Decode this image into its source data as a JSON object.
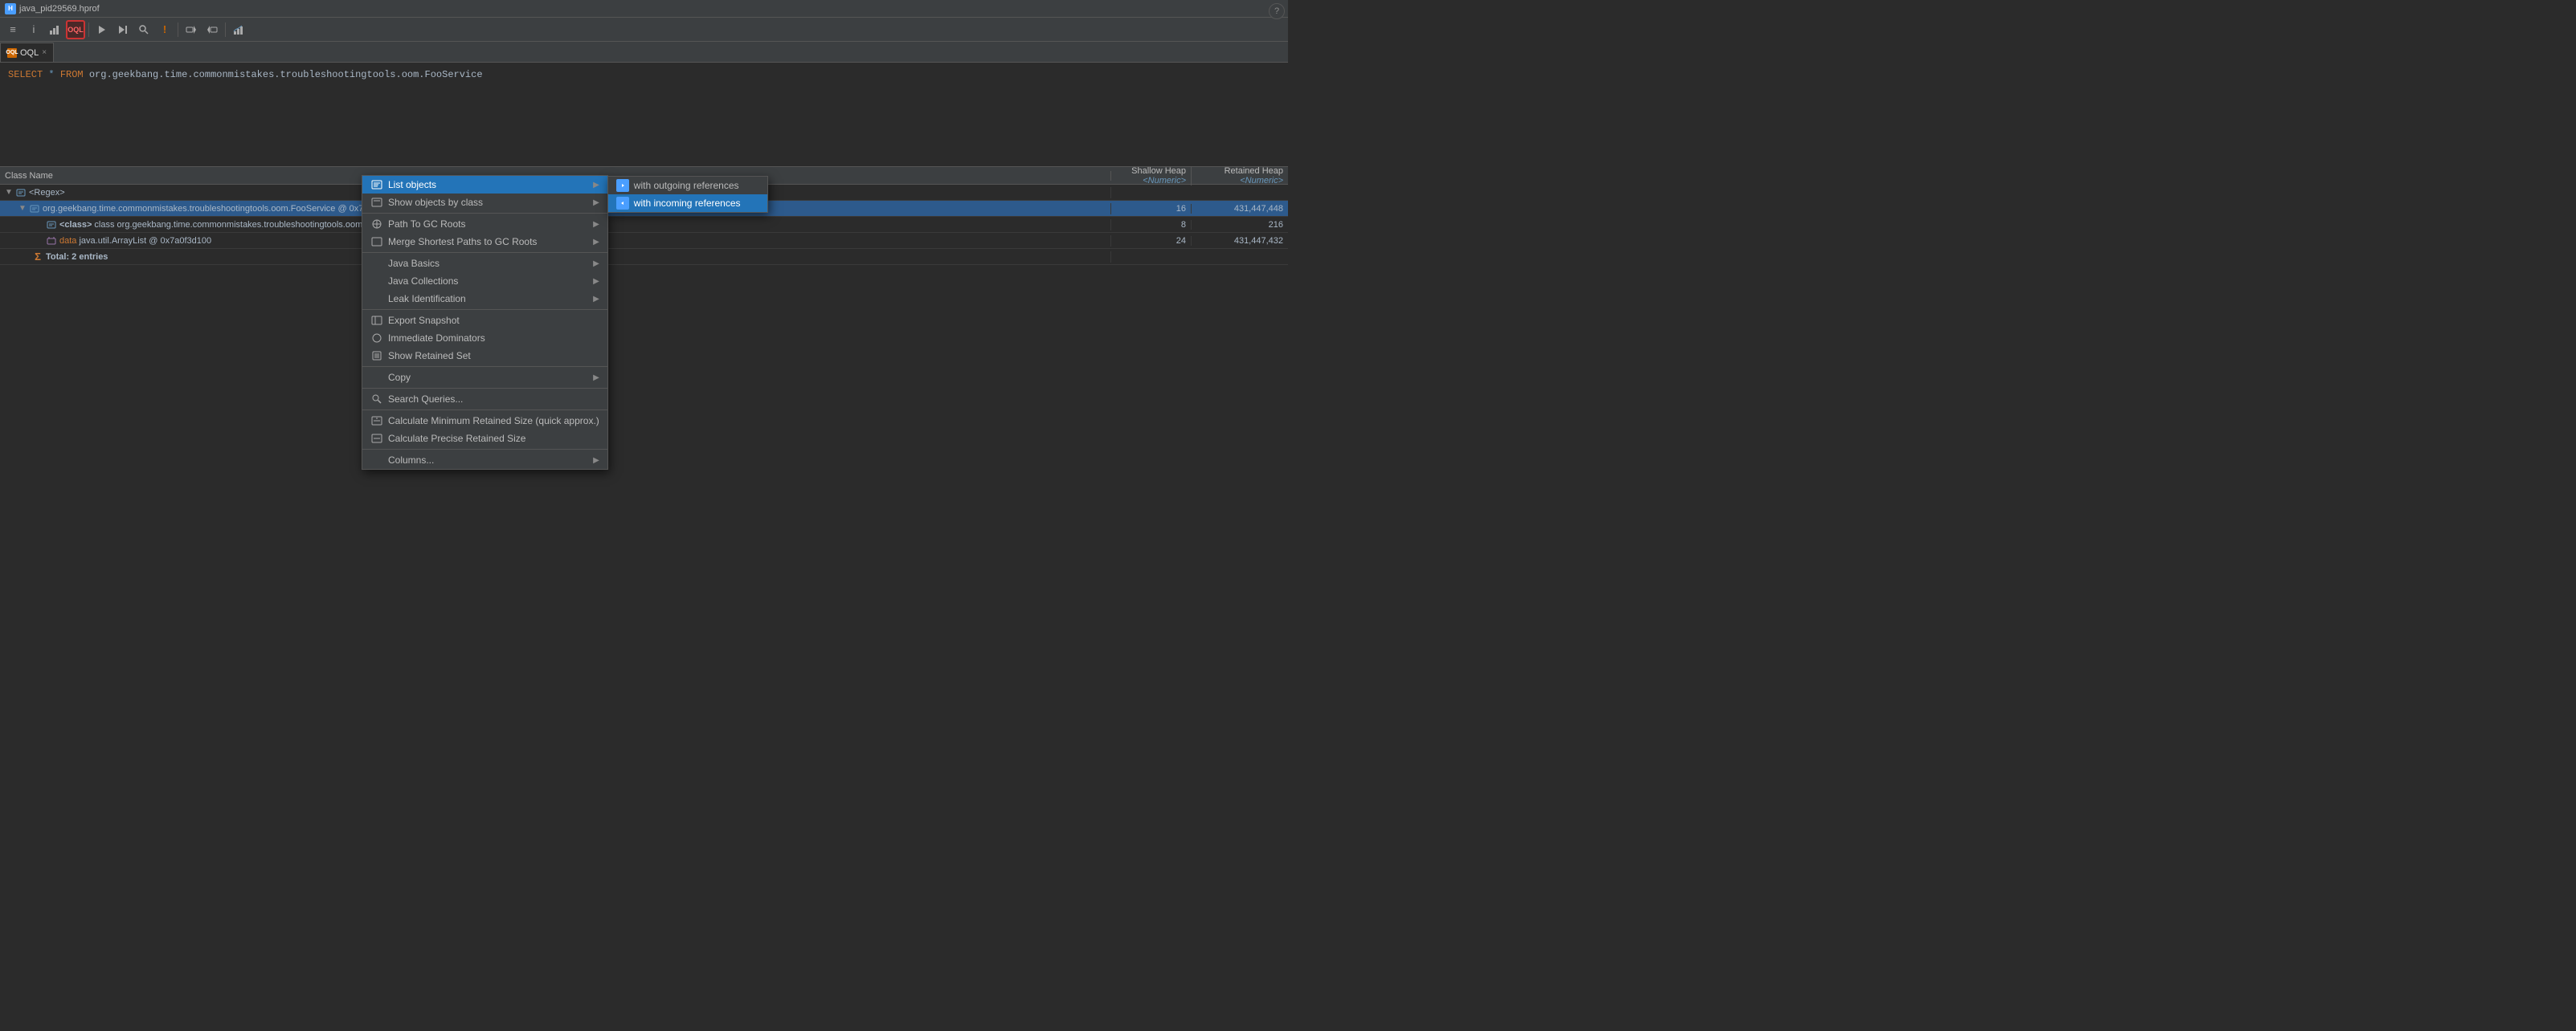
{
  "titleBar": {
    "icon": "H",
    "title": "java_pid29569.hprof",
    "closeIcon": "×"
  },
  "toolbar": {
    "buttons": [
      {
        "id": "tb1",
        "icon": "≡",
        "active": false
      },
      {
        "id": "tb2",
        "icon": "i",
        "active": false
      },
      {
        "id": "tb3",
        "icon": "▦",
        "active": false
      },
      {
        "id": "tb4",
        "icon": "OQL",
        "active": true,
        "highlight": true
      },
      {
        "id": "tb5",
        "icon": "⚙",
        "active": false
      },
      {
        "id": "tb6",
        "icon": "▶▶",
        "active": false
      },
      {
        "id": "tb7",
        "icon": "⚙▶",
        "active": false
      },
      {
        "id": "tb8",
        "icon": "🔍",
        "active": false
      },
      {
        "id": "tb9",
        "icon": "!",
        "active": false
      },
      {
        "id": "tb10",
        "icon": "▣",
        "active": false
      },
      {
        "id": "tb11",
        "icon": "→▣",
        "active": false
      },
      {
        "id": "tb12",
        "icon": "📊",
        "active": false
      }
    ]
  },
  "oqlTab": {
    "label": "OQL",
    "closeIcon": "×"
  },
  "editor": {
    "query": "SELECT * FROM org.geekbang.time.commonmistakes.troubleshootingtools.oom.FooService"
  },
  "table": {
    "headers": {
      "className": "Class Name",
      "shallowHeap": "Shallow Heap",
      "retainedHeap": "Retained Heap",
      "numericLabel": "<Numeric>"
    },
    "rows": [
      {
        "id": "row1",
        "indent": 0,
        "hasArrow": true,
        "expanded": true,
        "icon": "regex",
        "name": "<Regex>",
        "shallowHeap": "",
        "retainedHeap": ""
      },
      {
        "id": "row2",
        "indent": 1,
        "hasArrow": true,
        "expanded": true,
        "selected": true,
        "icon": "class",
        "name": "org.geekbang.time.commonmistakes.troubleshootingtools.oom.FooService @ 0x7a0f3d0f0",
        "shallowHeap": "16",
        "retainedHeap": "431,447,448"
      },
      {
        "id": "row3",
        "indent": 2,
        "hasArrow": false,
        "icon": "class",
        "name": "<class> class org.geekbang.time.commonmistakes.troubleshootingtools.oom.FooService @ 0x7a069ad40",
        "shallowHeap": "8",
        "retainedHeap": "216"
      },
      {
        "id": "row4",
        "indent": 2,
        "hasArrow": false,
        "icon": "field",
        "name": "data java.util.ArrayList @ 0x7a0f3d100",
        "shallowHeap": "24",
        "retainedHeap": "431,447,432"
      },
      {
        "id": "row5",
        "indent": 1,
        "hasArrow": false,
        "icon": "sigma",
        "name": "Total: 2 entries",
        "shallowHeap": "",
        "retainedHeap": ""
      }
    ]
  },
  "contextMenu": {
    "items": [
      {
        "id": "list-objects",
        "label": "List objects",
        "icon": "list",
        "hasSubmenu": true,
        "highlighted": true
      },
      {
        "id": "show-objects-by-class",
        "label": "Show objects by class",
        "icon": "class",
        "hasSubmenu": true
      },
      {
        "id": "sep1",
        "type": "separator"
      },
      {
        "id": "path-to-gc",
        "label": "Path To GC Roots",
        "icon": "path",
        "hasSubmenu": true
      },
      {
        "id": "merge-shortest",
        "label": "Merge Shortest Paths to GC Roots",
        "icon": "merge",
        "hasSubmenu": true
      },
      {
        "id": "sep2",
        "type": "separator"
      },
      {
        "id": "java-basics",
        "label": "Java Basics",
        "hasSubmenu": true
      },
      {
        "id": "java-collections",
        "label": "Java Collections",
        "hasSubmenu": true
      },
      {
        "id": "leak-identification",
        "label": "Leak Identification",
        "hasSubmenu": true
      },
      {
        "id": "sep3",
        "type": "separator"
      },
      {
        "id": "export-snapshot",
        "label": "Export Snapshot",
        "icon": "export"
      },
      {
        "id": "immediate-dominators",
        "label": "Immediate Dominators",
        "icon": "dominators"
      },
      {
        "id": "show-retained",
        "label": "Show Retained Set",
        "icon": "retained"
      },
      {
        "id": "sep4",
        "type": "separator"
      },
      {
        "id": "copy",
        "label": "Copy",
        "hasSubmenu": true
      },
      {
        "id": "sep5",
        "type": "separator"
      },
      {
        "id": "search-queries",
        "label": "Search Queries...",
        "icon": "search"
      },
      {
        "id": "sep6",
        "type": "separator"
      },
      {
        "id": "calc-min",
        "label": "Calculate Minimum Retained Size (quick approx.)",
        "icon": "calc"
      },
      {
        "id": "calc-precise",
        "label": "Calculate Precise Retained Size",
        "icon": "calc"
      },
      {
        "id": "sep7",
        "type": "separator"
      },
      {
        "id": "columns",
        "label": "Columns...",
        "hasSubmenu": true
      }
    ],
    "submenuListObjects": [
      {
        "id": "outgoing",
        "label": "with outgoing references",
        "icon": "arrow-out"
      },
      {
        "id": "incoming",
        "label": "with incoming references",
        "icon": "arrow-in",
        "active": true
      }
    ]
  },
  "help": "?"
}
